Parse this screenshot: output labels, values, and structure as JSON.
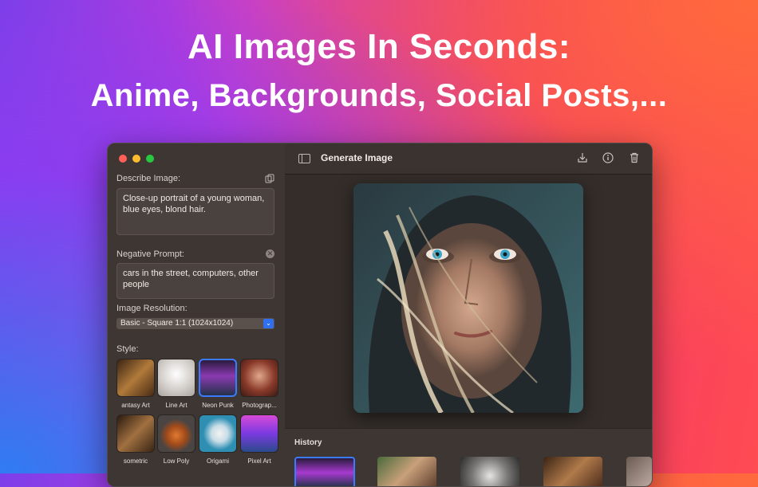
{
  "headline": {
    "line1": "AI Images In Seconds:",
    "line2": "Anime, Backgrounds, Social Posts,..."
  },
  "window": {
    "toolbar": {
      "title": "Generate Image",
      "icons": [
        "sidebar-toggle-icon",
        "download-icon",
        "info-icon",
        "trash-icon"
      ]
    },
    "sidebar": {
      "describe_label": "Describe Image:",
      "describe_value": "Close-up portrait of a young woman, blue eyes, blond hair.",
      "negative_label": "Negative Prompt:",
      "negative_value": "cars in the street, computers, other people",
      "resolution_label": "Image Resolution:",
      "resolution_value": "Basic - Square 1:1 (1024x1024)",
      "style_label": "Style:",
      "styles": [
        {
          "label": "antasy Art",
          "selected": false,
          "color": "#8b5a2b"
        },
        {
          "label": "Line Art",
          "selected": false,
          "color": "#d8d4cf"
        },
        {
          "label": "Neon Punk",
          "selected": true,
          "color": "#6a2a7a"
        },
        {
          "label": "Photograp...",
          "selected": false,
          "color": "#8a3a2a"
        },
        {
          "label": "sometric",
          "selected": false,
          "color": "#6a4a2e"
        },
        {
          "label": "Low Poly",
          "selected": false,
          "color": "#4a4543"
        },
        {
          "label": "Origami",
          "selected": false,
          "color": "#2e8fb3"
        },
        {
          "label": "Pixel Art",
          "selected": false,
          "color": "#b04ad8"
        }
      ]
    },
    "history": {
      "label": "History",
      "thumb_colors": [
        "#7b2fb0",
        "#8a6b4a",
        "#c9c7c5",
        "#6b4a35",
        "#a0908a"
      ]
    }
  }
}
